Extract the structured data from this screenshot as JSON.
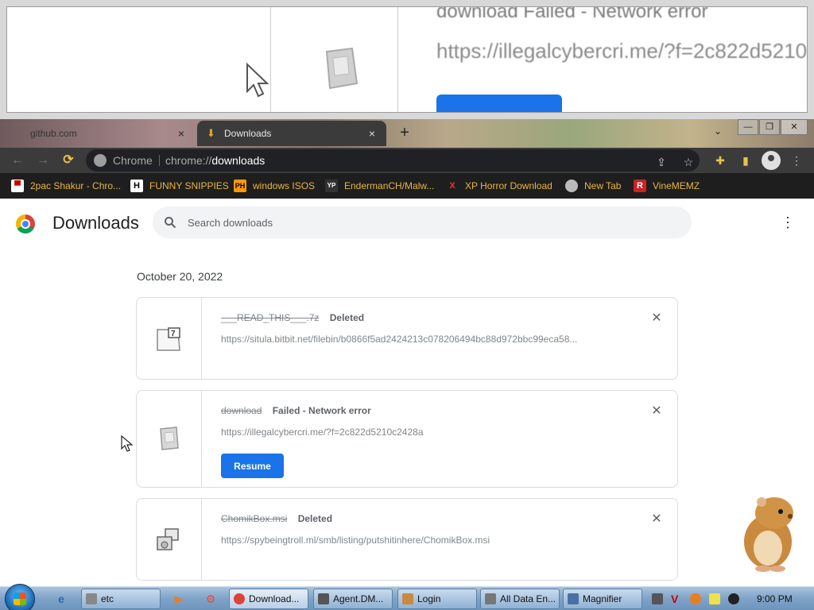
{
  "magnifier": {
    "text_status": "download Failed - Network error",
    "text_url": "https://illegalcybercri.me/?f=2c822d5210"
  },
  "tabs": [
    {
      "label": "github.com"
    },
    {
      "label": "Downloads"
    }
  ],
  "tab_close": "×",
  "new_tab": "+",
  "window_controls": {
    "minimize": "—",
    "maximize": "❐",
    "close": "✕"
  },
  "toolbar": {
    "back_icon": "←",
    "forward_icon": "→",
    "reload_icon": "C",
    "chip_label": "Chrome",
    "url_scheme": "chrome://",
    "url_path": "downloads"
  },
  "bookmarks": [
    {
      "label": "2pac Shakur - Chro...",
      "icon": "flag-icon"
    },
    {
      "label": "FUNNY SNIPPIES",
      "icon": "H"
    },
    {
      "label": "windows ISOS",
      "icon": "PH"
    },
    {
      "label": "EndermanCH/Malw...",
      "icon": "YP"
    },
    {
      "label": "XP Horror Download",
      "icon": "X"
    },
    {
      "label": "New Tab",
      "icon": "globe-icon"
    },
    {
      "label": "VineMEMZ",
      "icon": "R"
    }
  ],
  "page": {
    "title": "Downloads",
    "search_placeholder": "Search downloads",
    "date": "October 20, 2022",
    "downloads": [
      {
        "name": "___READ_THIS___.7z",
        "status": "Deleted",
        "url": "https://situla.bitbit.net/filebin/b0866f5ad2424213c078206494bc88d972bbc99eca58...",
        "icon": "7z-file-icon"
      },
      {
        "name": "download",
        "status": "Failed - Network error",
        "url": "https://illegalcybercri.me/?f=2c822d5210c2428a",
        "icon": "generic-file-icon",
        "action": "Resume"
      },
      {
        "name": "ChomikBox.msi",
        "status": "Deleted",
        "url": "https://spybeingtroll.ml/smb/listing/putshitinhere/ChomikBox.msi",
        "icon": "installer-icon"
      }
    ],
    "remove_label": "✕"
  },
  "taskbar": {
    "items": [
      {
        "label": "etc"
      },
      {
        "label": "Download..."
      },
      {
        "label": "Agent.DM..."
      },
      {
        "label": "Login"
      },
      {
        "label": "All Data En..."
      },
      {
        "label": "Magnifier"
      }
    ],
    "clock": "9:00 PM"
  }
}
